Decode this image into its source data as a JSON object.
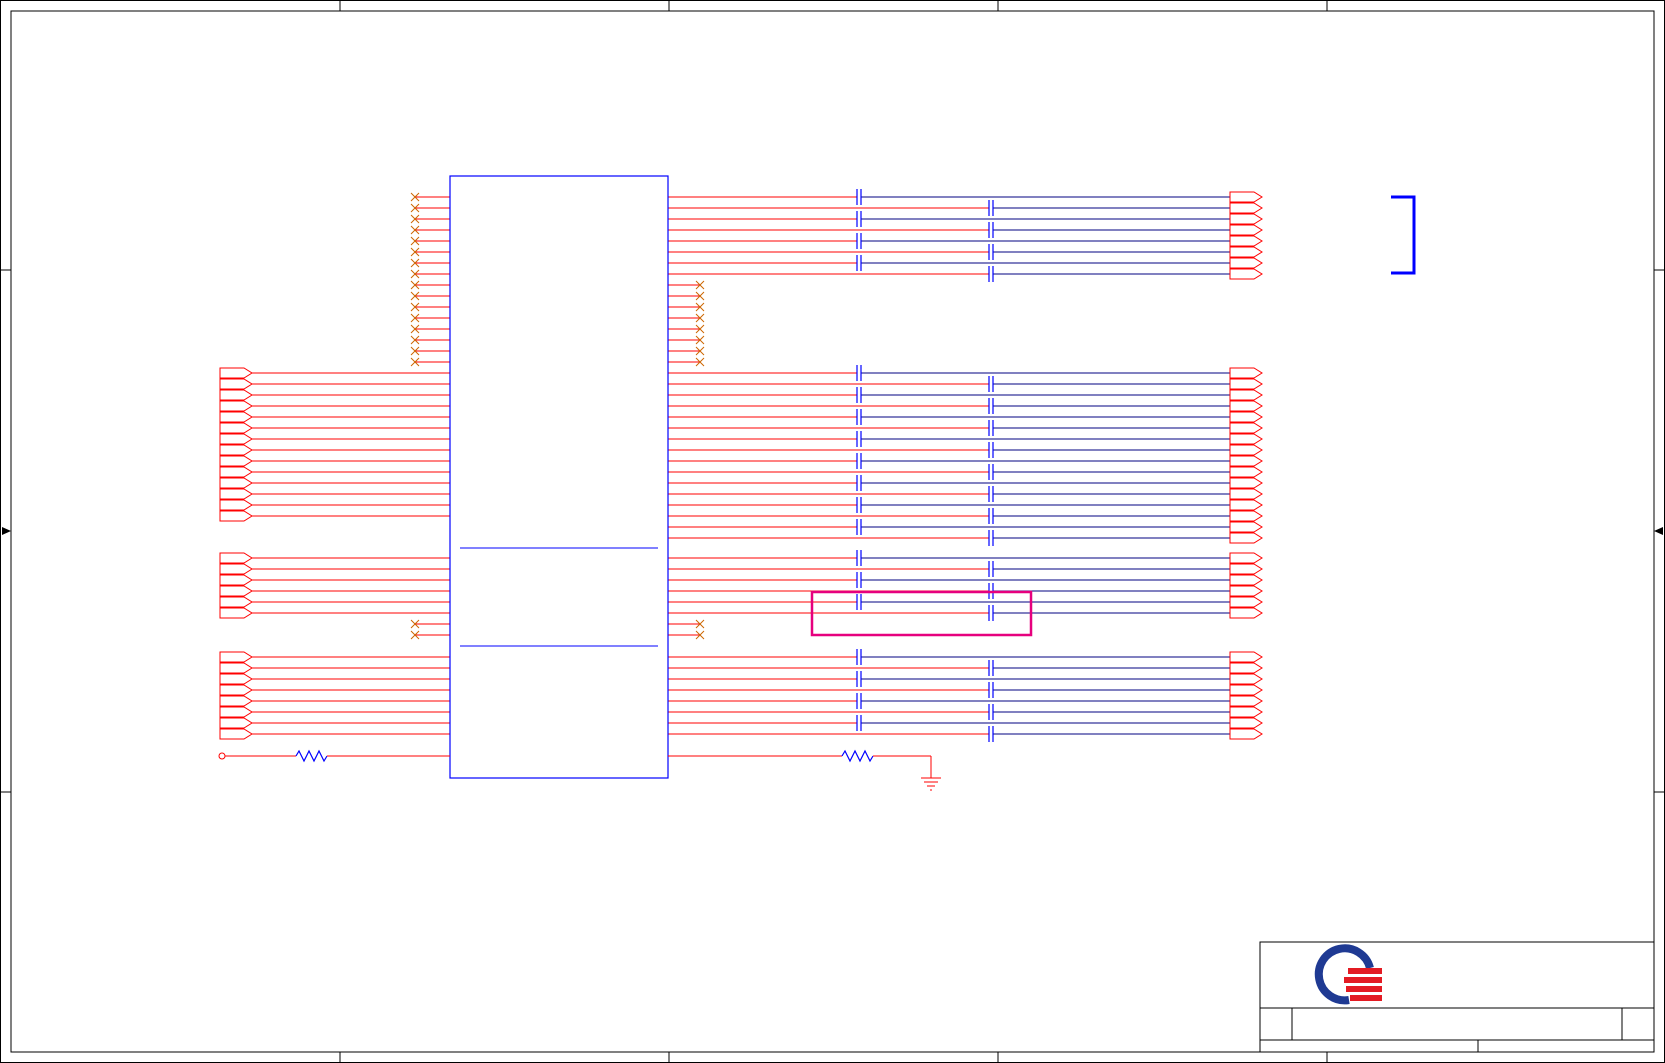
{
  "sheet": {
    "frame_color": "#000000",
    "wire_color": "#ff0000",
    "body_color": "#0000ff",
    "highlight_color": "#e6007e",
    "logo": {
      "icon": "quanta-q-logo",
      "ring_color": "#1f3a93",
      "stripe_color": "#e31b23"
    }
  },
  "connector_ic": {
    "left_nc_pins": 16,
    "right_nc_pins": 8,
    "left_input_groups": [
      14,
      6,
      8
    ],
    "right_output_groups": [
      8,
      16,
      6,
      8
    ],
    "mid_nc_pins": 2
  }
}
